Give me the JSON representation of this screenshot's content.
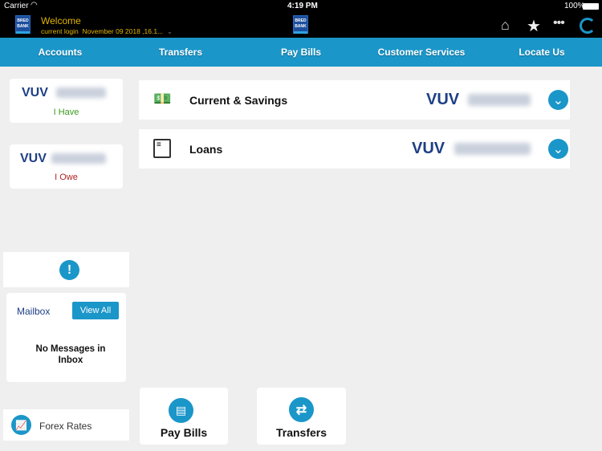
{
  "status_bar": {
    "carrier": "Carrier",
    "time": "4:19 PM",
    "battery": "100%"
  },
  "header": {
    "logo_text": "BRED BANK",
    "welcome": "Welcome",
    "login_label": "current login",
    "login_value": "November 09 2018 ,16.1..."
  },
  "nav": {
    "items": [
      "Accounts",
      "Transfers",
      "Pay Bills",
      "Customer Services",
      "Locate Us"
    ]
  },
  "summary": {
    "have": {
      "currency": "VUV",
      "label": "I Have"
    },
    "owe": {
      "currency": "VUV",
      "label": "I Owe"
    }
  },
  "accounts": [
    {
      "name": "Current & Savings",
      "currency": "VUV",
      "icon": "money-icon"
    },
    {
      "name": "Loans",
      "currency": "VUV",
      "icon": "document-icon"
    }
  ],
  "mailbox": {
    "title": "Mailbox",
    "view_all": "View All",
    "empty": "No Messages in Inbox"
  },
  "forex": {
    "label": "Forex Rates"
  },
  "tiles": [
    {
      "label": "Pay Bills",
      "icon": "pay-bills-icon"
    },
    {
      "label": "Transfers",
      "icon": "transfer-arrows-icon"
    }
  ],
  "colors": {
    "accent": "#1b96c9",
    "navy": "#1e3f86",
    "have": "#3a9a1e",
    "owe": "#b22222",
    "header_text": "#e0b400"
  }
}
